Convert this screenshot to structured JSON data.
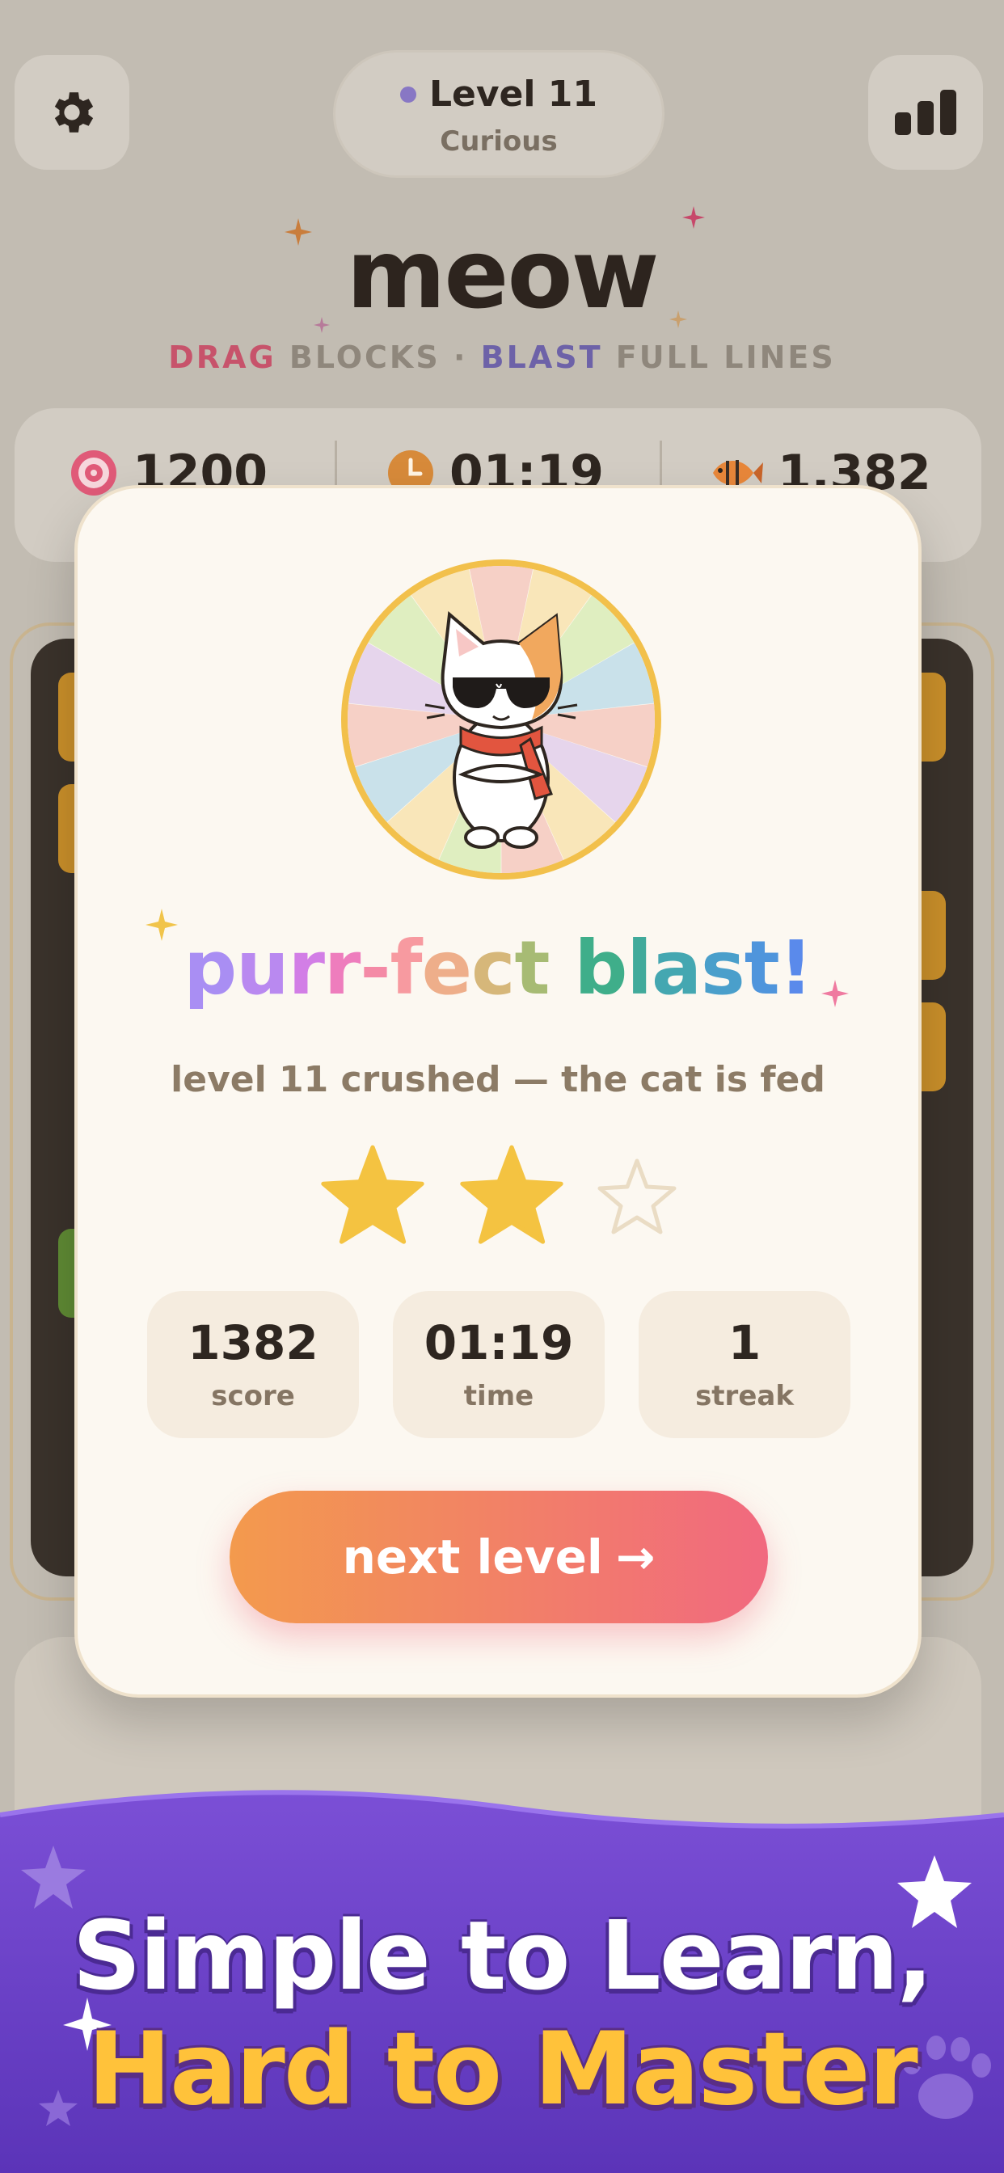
{
  "topbar": {
    "settings_icon": "gear-icon",
    "leaderboard_icon": "bar-chart-icon",
    "level_title": "Level 11",
    "level_subtitle": "Curious"
  },
  "game": {
    "title": "meow",
    "subtitle": {
      "w1": "DRAG",
      "w2": "BLOCKS",
      "sep": "·",
      "w3": "BLAST",
      "w4": "FULL LINES"
    }
  },
  "stats_bar": {
    "target": "1200",
    "time": "01:19",
    "fish": "1.382",
    "target_icon": "target-icon",
    "time_icon": "clock-icon",
    "fish_icon": "fish-icon"
  },
  "modal": {
    "headline": [
      "p",
      "u",
      "r",
      "r",
      "-",
      "f",
      "e",
      "c",
      "t",
      " ",
      "b",
      "l",
      "a",
      "s",
      "t",
      "!"
    ],
    "headline_colors": [
      "#a98ef3",
      "#b989f0",
      "#d27ee6",
      "#ee7dbd",
      "#f48aa6",
      "#f79aa0",
      "#eeae8a",
      "#d6b77a",
      "#a7bb74",
      "#62b57f",
      "#3fae8a",
      "#41aa9b",
      "#44a7b1",
      "#4a9fcb",
      "#4f95dc",
      "#5a8aeb"
    ],
    "tagline": "level 11 crushed — the cat is fed",
    "stars_earned": 2,
    "stars_total": 3,
    "stats": [
      {
        "value": "1382",
        "label": "score"
      },
      {
        "value": "01:19",
        "label": "time"
      },
      {
        "value": "1",
        "label": "streak"
      }
    ],
    "next_button": "next level",
    "next_arrow": "→"
  },
  "promo": {
    "line1": "Simple to Learn,",
    "line2": "Hard to Master"
  },
  "colors": {
    "accent_gold": "#f2c04b",
    "button_start": "#f39a4d",
    "button_end": "#f1697f",
    "promo_purple": "#6a3fc4"
  }
}
